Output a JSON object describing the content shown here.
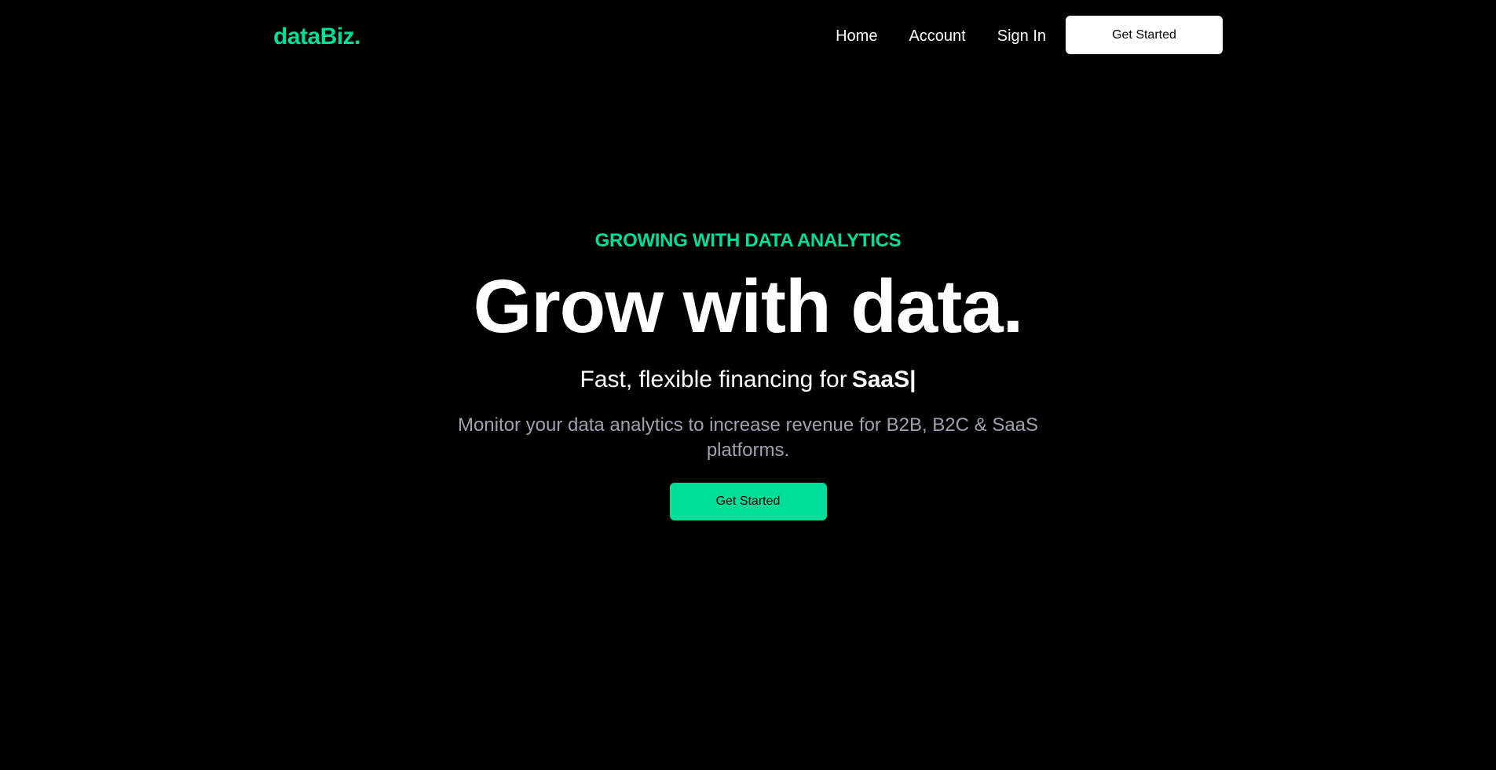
{
  "colors": {
    "background": "#000000",
    "accent": "#00df9a",
    "text": "#ffffff",
    "muted": "#9ca3af"
  },
  "navbar": {
    "logo": "dataBiz.",
    "links": [
      "Home",
      "Account",
      "Sign In"
    ],
    "cta_label": "Get Started"
  },
  "hero": {
    "eyebrow": "GROWING WITH DATA ANALYTICS",
    "headline": "Grow with data.",
    "tagline_prefix": "Fast, flexible financing for",
    "tagline_typed": "SaaS|",
    "description": "Monitor your data analytics to increase revenue for B2B, B2C & SaaS platforms.",
    "cta_label": "Get Started"
  }
}
